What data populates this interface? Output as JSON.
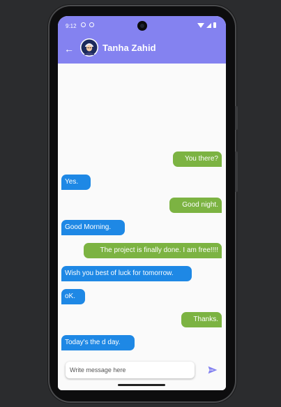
{
  "status_bar": {
    "time": "9:12"
  },
  "header": {
    "contact_name": "Tanha Zahid",
    "back_icon": "arrow-left-icon",
    "avatar_icon": "user-avatar"
  },
  "messages": [
    {
      "text": "You there?",
      "type": "sent"
    },
    {
      "text": "Yes.",
      "type": "received"
    },
    {
      "text": "Good night.",
      "type": "sent"
    },
    {
      "text": "Good Morning.",
      "type": "received"
    },
    {
      "text": "The project is finally done. I am free!!!!",
      "type": "sent"
    },
    {
      "text": "Wish you best of luck for tomorrow.",
      "type": "received"
    },
    {
      "text": "oK.",
      "type": "received"
    },
    {
      "text": "Thanks.",
      "type": "sent"
    },
    {
      "text": "Today's the d day.",
      "type": "received"
    }
  ],
  "composer": {
    "placeholder": "Write message here",
    "value": "",
    "send_icon": "send-icon"
  },
  "colors": {
    "app_bar": "#8482f0",
    "sent_bubble": "#7cb342",
    "received_bubble": "#1e88e5",
    "background": "#fafafa"
  }
}
